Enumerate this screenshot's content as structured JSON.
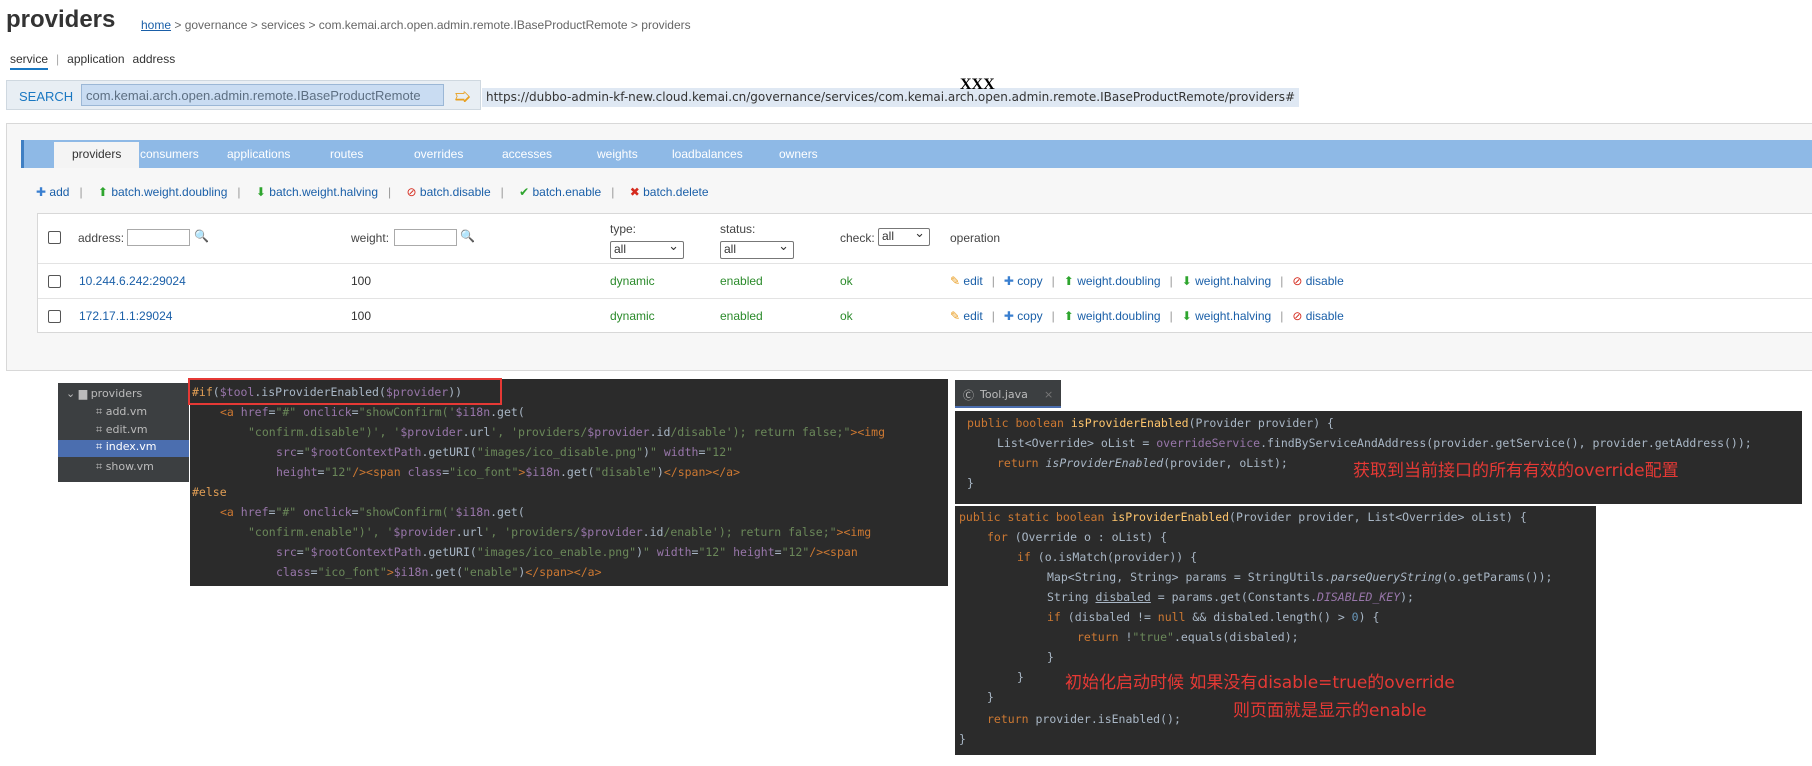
{
  "page": {
    "title": "providers",
    "breadcrumb": {
      "home": "home",
      "rest": " > governance > services > com.kemai.arch.open.admin.remote.IBaseProductRemote > providers"
    },
    "subnav": [
      "service",
      "application",
      "address"
    ]
  },
  "search": {
    "label": "SEARCH",
    "value": "com.kemai.arch.open.admin.remote.IBaseProductRemote",
    "go_icon": "arrow-right-icon"
  },
  "url": "https://dubbo-admin-kf-new.cloud.kemai.cn/governance/services/com.kemai.arch.open.admin.remote.IBaseProductRemote/providers#",
  "overlay_text": "XXX",
  "tabs": [
    "providers",
    "consumers",
    "applications",
    "routes",
    "overrides",
    "accesses",
    "weights",
    "loadbalances",
    "owners"
  ],
  "actions": [
    "add",
    "batch.weight.doubling",
    "batch.weight.halving",
    "batch.disable",
    "batch.enable",
    "batch.delete"
  ],
  "table": {
    "headers": {
      "address": "address:",
      "weight": "weight:",
      "type": "type:",
      "status": "status:",
      "check": "check:",
      "operation": "operation"
    },
    "filters": {
      "type": "all",
      "status": "all",
      "check": "all"
    },
    "rows": [
      {
        "address": "10.244.6.242:29024",
        "weight": "100",
        "type": "dynamic",
        "status": "enabled",
        "check": "ok"
      },
      {
        "address": "172.17.1.1:29024",
        "weight": "100",
        "type": "dynamic",
        "status": "enabled",
        "check": "ok"
      }
    ],
    "ops": [
      "edit",
      "copy",
      "weight.doubling",
      "weight.halving",
      "disable"
    ]
  },
  "ide": {
    "tree": {
      "folder": "providers",
      "files": [
        "add.vm",
        "edit.vm",
        "index.vm",
        "show.vm"
      ],
      "selected": "index.vm"
    },
    "file_tab": "Tool.java",
    "annotation_1": "获取到当前接口的所有有效的override配置",
    "annotation_2": "初始化启动时候 如果没有disable=true的override",
    "annotation_3": "则页面就是显示的enable"
  },
  "colors": {
    "link": "#1a5fa8",
    "tab_bar": "#8eb9e6",
    "status_green": "#2a8a2a",
    "annotation_red": "#e53935"
  }
}
